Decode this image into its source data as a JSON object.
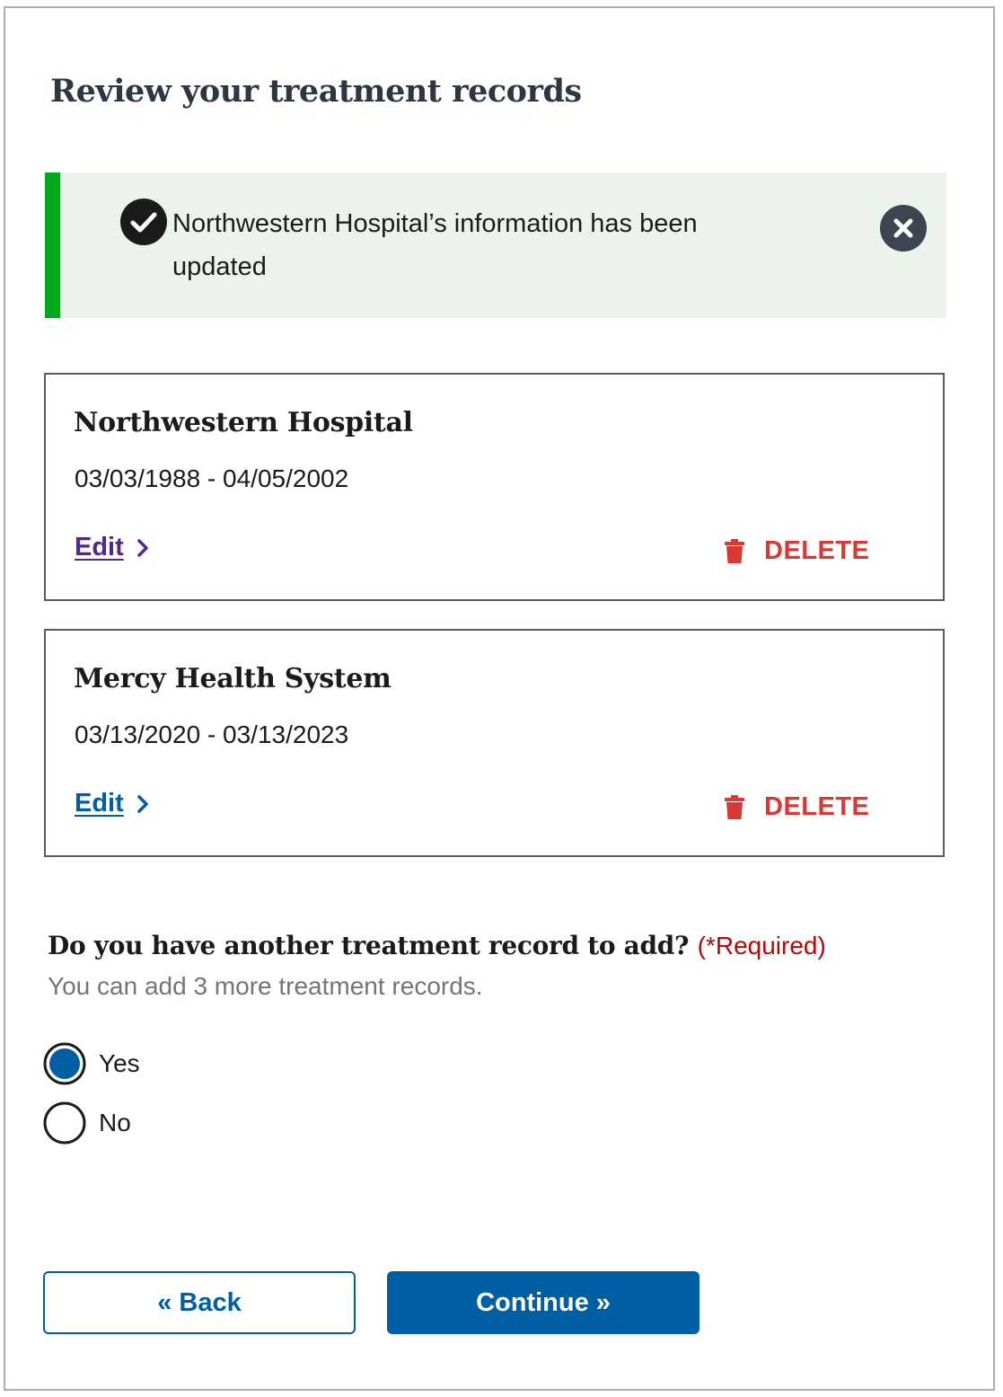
{
  "page": {
    "title": "Review your treatment records"
  },
  "alert": {
    "message": "Northwestern Hospital’s information has been updated",
    "status_color": "#00a91c",
    "icon": "check-circle-icon",
    "close_icon": "close-circle-icon"
  },
  "records": [
    {
      "name": "Northwestern Hospital",
      "dates": "03/03/1988 - 04/05/2002",
      "edit_label": "Edit",
      "delete_label": "DELETE"
    },
    {
      "name": "Mercy Health System",
      "dates": "03/13/2020 - 03/13/2023",
      "edit_label": "Edit",
      "delete_label": "DELETE"
    }
  ],
  "question": {
    "label": "Do you have another treatment record to add?",
    "required": "(*Required)",
    "hint": "You can add 3 more treatment records.",
    "options": [
      {
        "label": "Yes",
        "selected": true
      },
      {
        "label": "No",
        "selected": false
      }
    ]
  },
  "buttons": {
    "back": "« Back",
    "continue": "Continue »"
  },
  "colors": {
    "primary": "#005ea2",
    "visited_link": "#54278f",
    "danger": "#d83933",
    "required": "#b50909",
    "alert_bg": "#ecf3ec"
  }
}
